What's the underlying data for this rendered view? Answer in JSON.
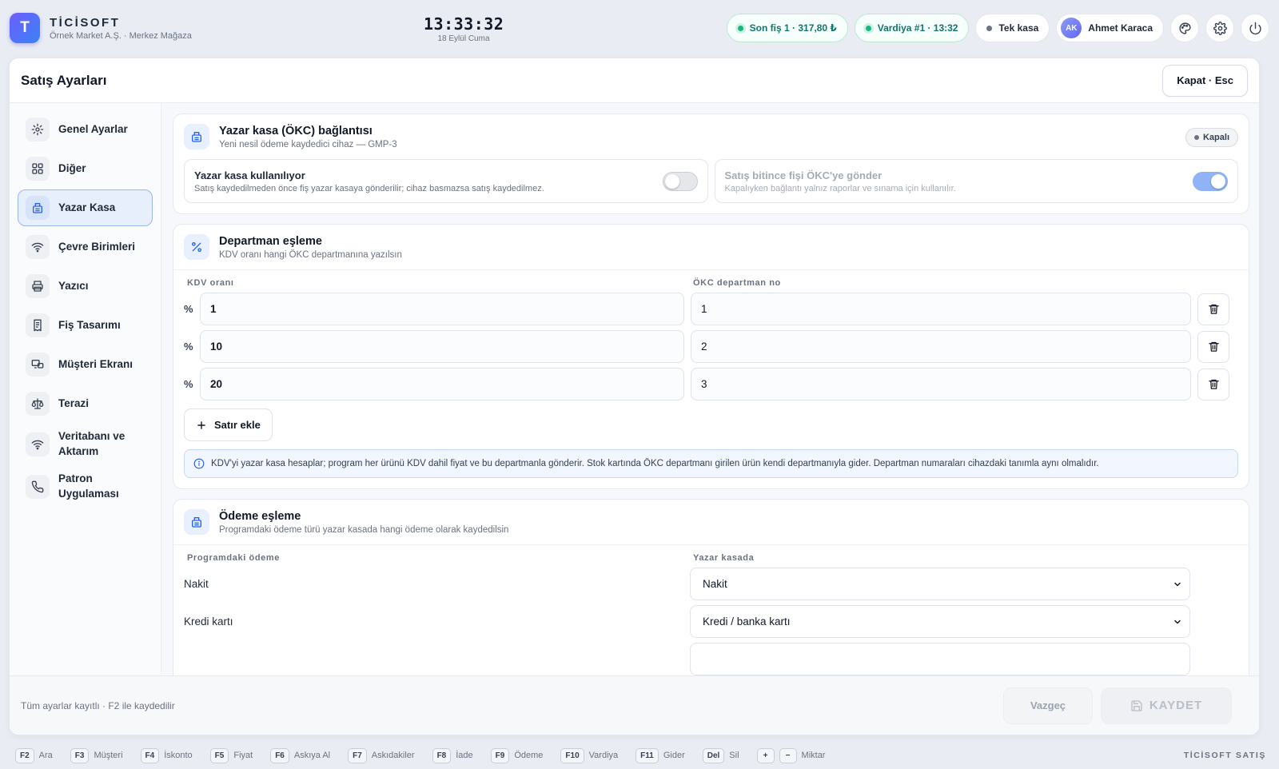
{
  "app": {
    "logo_letter": "T",
    "name": "TİCİSOFT",
    "subtitle": "Örnek Market A.Ş. · Merkez Mağaza",
    "accent": "#4f6ef7"
  },
  "clock": {
    "time": "13:33:32",
    "date": "18 Eylül Cuma"
  },
  "status": {
    "last_receipt": "Son fiş 1 · 317,80 ₺",
    "shift": "Vardiya #1 · 13:32",
    "register": "Tek kasa"
  },
  "user": {
    "initials": "AK",
    "name": "Ahmet Karaca"
  },
  "panel": {
    "title": "Satış Ayarları",
    "close_label": "Kapat · Esc"
  },
  "sidebar": {
    "items": [
      {
        "label": "Genel Ayarlar",
        "icon": "gear-icon"
      },
      {
        "label": "Diğer",
        "icon": "grid-icon"
      },
      {
        "label": "Yazar Kasa",
        "icon": "register-icon",
        "active": true
      },
      {
        "label": "Çevre Birimleri",
        "icon": "wifi-icon"
      },
      {
        "label": "Yazıcı",
        "icon": "printer-icon"
      },
      {
        "label": "Fiş Tasarımı",
        "icon": "receipt-icon"
      },
      {
        "label": "Müşteri Ekranı",
        "icon": "monitor-icon"
      },
      {
        "label": "Terazi",
        "icon": "scale-icon"
      },
      {
        "label": "Veritabanı ve Aktarım",
        "icon": "wifi-icon"
      },
      {
        "label": "Patron Uygulaması",
        "icon": "phone-icon"
      }
    ]
  },
  "okc": {
    "title": "Yazar kasa (ÖKC) bağlantısı",
    "subtitle": "Yeni nesil ödeme kaydedici cihaz — GMP-3",
    "badge": "Kapalı",
    "toggle1": {
      "title": "Yazar kasa kullanılıyor",
      "desc": "Satış kaydedilmeden önce fiş yazar kasaya gönderilir; cihaz basmazsa satış kaydedilmez.",
      "on": false
    },
    "toggle2": {
      "title": "Satış bitince fişi ÖKC'ye gönder",
      "desc": "Kapalıyken bağlantı yalnız raporlar ve sınama için kullanılır.",
      "on": true,
      "disabled": true
    }
  },
  "departments": {
    "title": "Departman eşleme",
    "subtitle": "KDV oranı hangi ÖKC departmanına yazılsın",
    "col_kdv": "KDV oranı",
    "col_okc": "ÖKC departman no",
    "percent_symbol": "%",
    "rows": [
      {
        "kdv": "1",
        "okc": "1"
      },
      {
        "kdv": "10",
        "okc": "2"
      },
      {
        "kdv": "20",
        "okc": "3"
      }
    ],
    "add_label": "Satır ekle",
    "info": "KDV'yi yazar kasa hesaplar; program her ürünü KDV dahil fiyat ve bu departmanla gönderir. Stok kartında ÖKC departmanı girilen ürün kendi departmanıyla gider. Departman numaraları cihazdaki tanımla aynı olmalıdır."
  },
  "payments": {
    "title": "Ödeme eşleme",
    "subtitle": "Programdaki ödeme türü yazar kasada hangi ödeme olarak kaydedilsin",
    "col_program": "Programdaki ödeme",
    "col_okc": "Yazar kasada",
    "rows": [
      {
        "program": "Nakit",
        "okc": "Nakit"
      },
      {
        "program": "Kredi kartı",
        "okc": "Kredi / banka kartı"
      }
    ]
  },
  "footer": {
    "status": "Tüm ayarlar kayıtlı · F2 ile kaydedilir",
    "cancel_label": "Vazgeç",
    "save_label": "KAYDET"
  },
  "shortcuts": [
    {
      "key": "F2",
      "label": "Ara"
    },
    {
      "key": "F3",
      "label": "Müşteri"
    },
    {
      "key": "F4",
      "label": "İskonto"
    },
    {
      "key": "F5",
      "label": "Fiyat"
    },
    {
      "key": "F6",
      "label": "Askıya Al"
    },
    {
      "key": "F7",
      "label": "Askıdakiler"
    },
    {
      "key": "F8",
      "label": "İade"
    },
    {
      "key": "F9",
      "label": "Ödeme"
    },
    {
      "key": "F10",
      "label": "Vardiya"
    },
    {
      "key": "F11",
      "label": "Gider"
    },
    {
      "key": "Del",
      "label": "Sil"
    }
  ],
  "qty_shortcut": {
    "key_plus": "+",
    "key_minus": "−",
    "label": "Miktar"
  },
  "brand_footer": "TİCİSOFT SATIŞ"
}
